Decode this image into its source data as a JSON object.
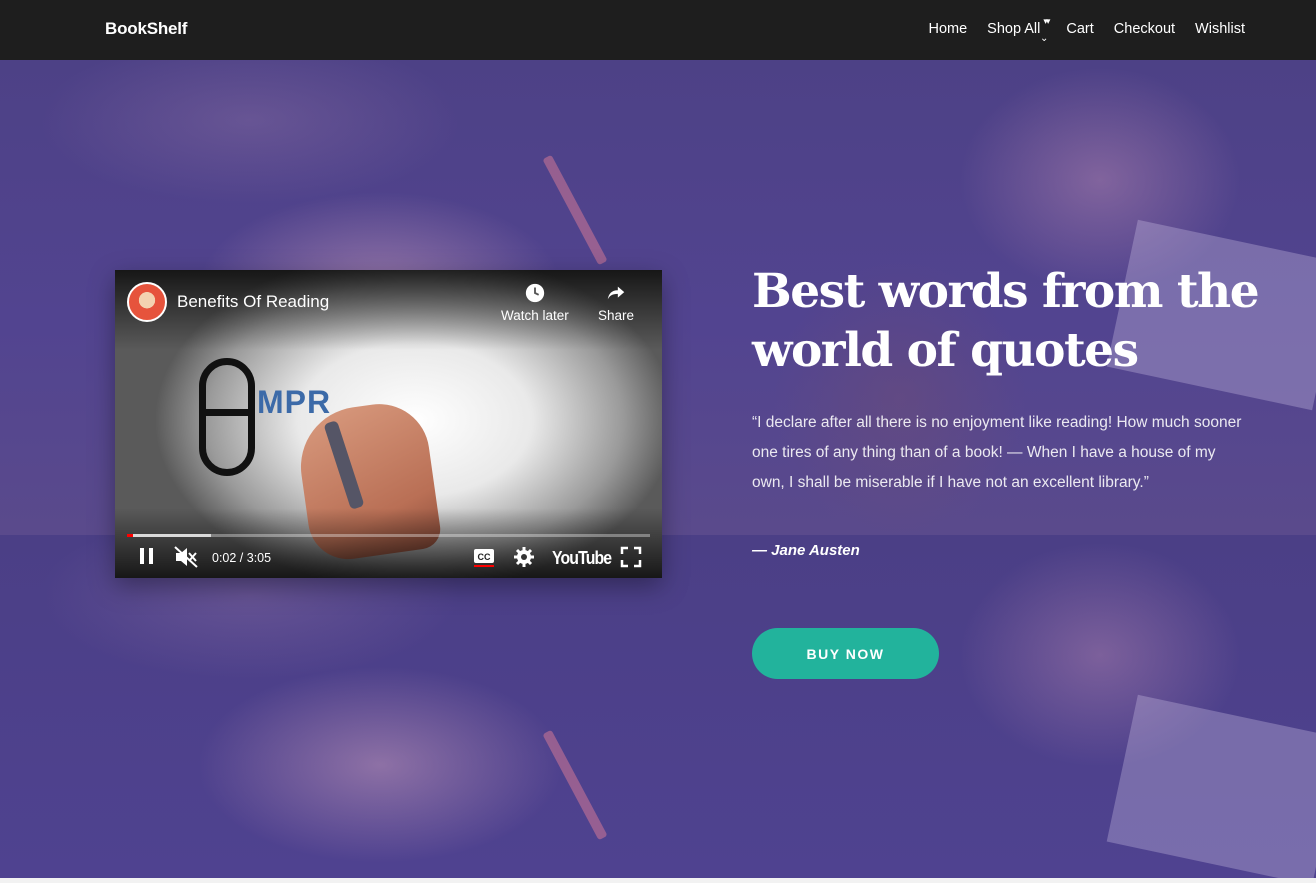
{
  "nav": {
    "brand": "BookShelf",
    "links": [
      {
        "label": "Home"
      },
      {
        "label": "Shop All",
        "has_dropdown": true
      },
      {
        "label": "Cart"
      },
      {
        "label": "Checkout"
      },
      {
        "label": "Wishlist"
      }
    ]
  },
  "video": {
    "title": "Benefits Of Reading",
    "watch_later": "Watch later",
    "share": "Share",
    "time": "0:02 / 3:05",
    "progress_played": 0.011,
    "progress_loaded": 0.16,
    "platform_logo": "YouTube",
    "drawn_text": "MPR",
    "icons": [
      "clock-icon",
      "share-icon",
      "pause-icon",
      "mute-icon",
      "captions-icon",
      "settings-icon",
      "fullscreen-icon"
    ]
  },
  "hero": {
    "title": "Best words from the world of quotes",
    "quote": "“I declare after all there is no enjoyment like reading! How much sooner one tires of any thing than of a book! — When I have a house of my own, I shall be miserable if I have not an excellent library.”",
    "author": "— Jane Austen",
    "cta": "BUY NOW"
  },
  "colors": {
    "nav_bg": "#1e1e1e",
    "hero_overlay": "#4a3f84",
    "cta": "#22b39c",
    "progress_red": "#ff0000"
  }
}
